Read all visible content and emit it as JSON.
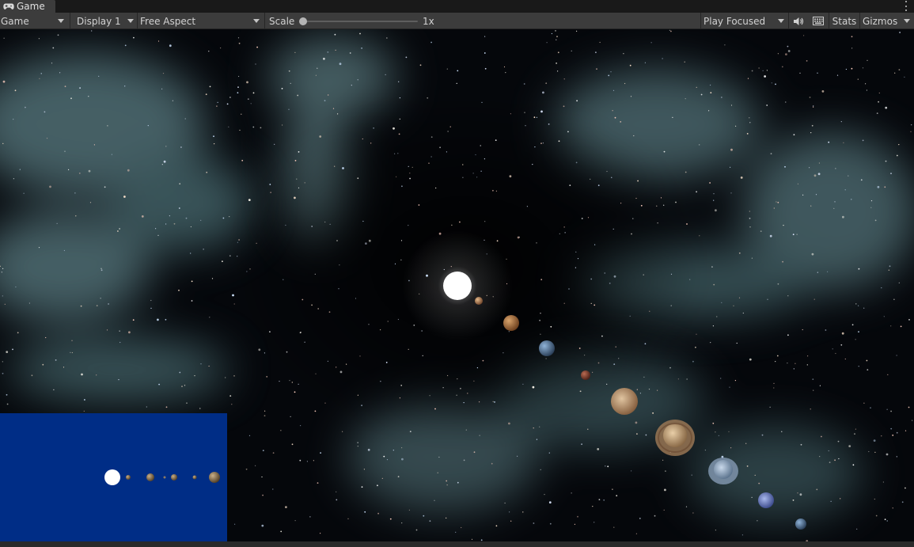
{
  "tab": {
    "label": "Game",
    "icon": "gamepad-icon"
  },
  "toolbar": {
    "view_mode": "Game",
    "display": "Display 1",
    "aspect": "Free Aspect",
    "scale_label": "Scale",
    "scale_value": "1x",
    "scale_level": 0.0,
    "play_mode": "Play Focused",
    "stats_label": "Stats",
    "gizmos_label": "Gizmos"
  },
  "scene": {
    "background_color": "#05070b",
    "nebula_color": "#8fb3b8",
    "sun_color": "#ffffff",
    "bodies": [
      "sun",
      "mercury",
      "venus",
      "earth",
      "mars",
      "jupiter",
      "saturn",
      "uranus",
      "neptune",
      "pluto"
    ]
  },
  "minimap": {
    "background_color": "#002d86",
    "bodies": [
      "sun",
      "mercury",
      "venus",
      "earth",
      "mars",
      "jupiter"
    ]
  }
}
